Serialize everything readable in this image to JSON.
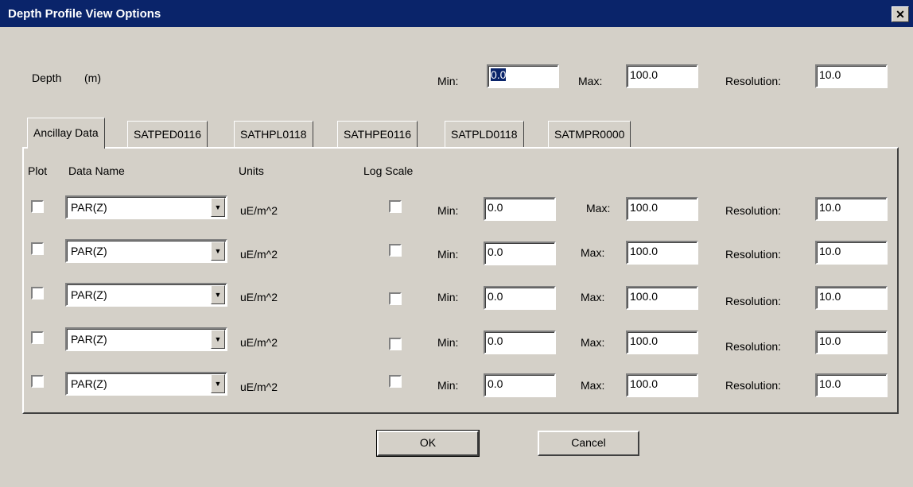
{
  "window": {
    "title": "Depth Profile View Options",
    "close_glyph": "✕"
  },
  "depth": {
    "label": "Depth",
    "unit": "(m)",
    "min_label": "Min:",
    "min": "0.0",
    "max_label": "Max:",
    "max": "100.0",
    "res_label": "Resolution:",
    "res": "10.0"
  },
  "tabs": [
    {
      "label": "Ancillay Data"
    },
    {
      "label": "SATPED0116"
    },
    {
      "label": "SATHPL0118"
    },
    {
      "label": "SATHPE0116"
    },
    {
      "label": "SATPLD0118"
    },
    {
      "label": "SATMPR0000"
    }
  ],
  "headers": {
    "plot": "Plot",
    "data_name": "Data Name",
    "units": "Units",
    "log_scale": "Log Scale"
  },
  "rows": [
    {
      "data_name": "PAR(Z)",
      "units": "uE/m^2",
      "min_label": "Min:",
      "min": "0.0",
      "max_label": "Max:",
      "max": "100.0",
      "res_label": "Resolution:",
      "res": "10.0",
      "plot": false,
      "log": false
    },
    {
      "data_name": "PAR(Z)",
      "units": "uE/m^2",
      "min_label": "Min:",
      "min": "0.0",
      "max_label": "Max:",
      "max": "100.0",
      "res_label": "Resolution:",
      "res": "10.0",
      "plot": false,
      "log": false
    },
    {
      "data_name": "PAR(Z)",
      "units": "uE/m^2",
      "min_label": "Min:",
      "min": "0.0",
      "max_label": "Max:",
      "max": "100.0",
      "res_label": "Resolution:",
      "res": "10.0",
      "plot": false,
      "log": false
    },
    {
      "data_name": "PAR(Z)",
      "units": "uE/m^2",
      "min_label": "Min:",
      "min": "0.0",
      "max_label": "Max:",
      "max": "100.0",
      "res_label": "Resolution:",
      "res": "10.0",
      "plot": false,
      "log": false
    },
    {
      "data_name": "PAR(Z)",
      "units": "uE/m^2",
      "min_label": "Min:",
      "min": "0.0",
      "max_label": "Max:",
      "max": "100.0",
      "res_label": "Resolution:",
      "res": "10.0",
      "plot": false,
      "log": false
    }
  ],
  "buttons": {
    "ok": "OK",
    "cancel": "Cancel"
  },
  "icons": {
    "dropdown": "dropdown-arrow-icon",
    "close": "close-icon"
  },
  "colors": {
    "titlebar": "#0a246a",
    "face": "#d4d0c8",
    "selection": "#0a246a"
  }
}
